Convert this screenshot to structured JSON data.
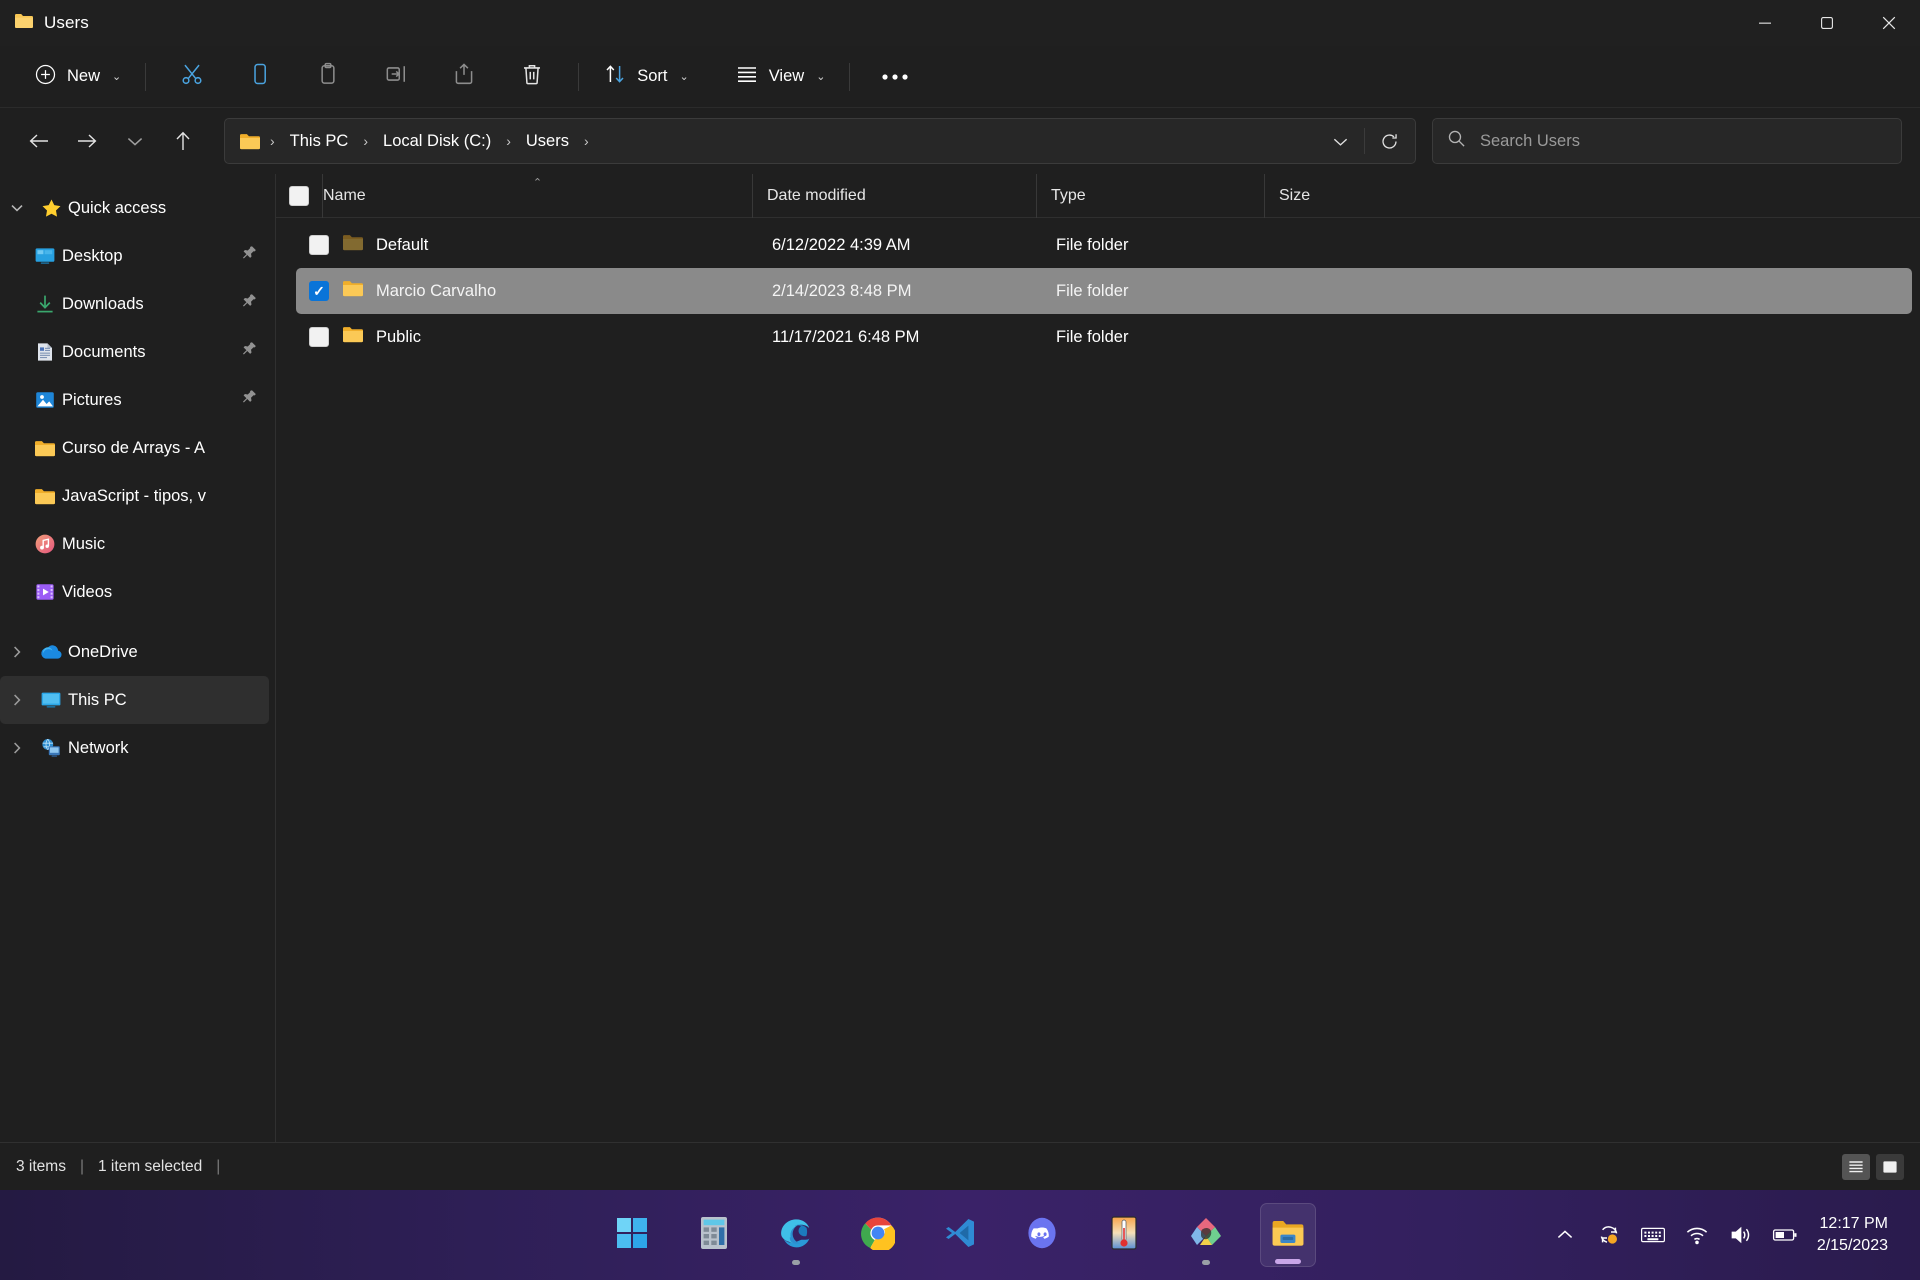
{
  "window": {
    "title": "Users",
    "title_icon": "folder-icon",
    "controls": {
      "minimize": "minimize-icon",
      "maximize": "maximize-icon",
      "close": "close-icon"
    }
  },
  "toolbar": {
    "new_label": "New",
    "new_icon": "plus-circle-icon",
    "actions": [
      {
        "name": "cut",
        "icon": "scissors-icon",
        "accent": true
      },
      {
        "name": "copy",
        "icon": "copy-icon",
        "accent": true
      },
      {
        "name": "paste",
        "icon": "clipboard-icon",
        "accent": false
      },
      {
        "name": "rename",
        "icon": "rename-icon",
        "accent": false
      },
      {
        "name": "share",
        "icon": "share-icon",
        "accent": false
      },
      {
        "name": "delete",
        "icon": "trash-icon",
        "accent": false
      }
    ],
    "sort_label": "Sort",
    "sort_icon": "sort-arrows-icon",
    "view_label": "View",
    "view_icon": "list-lines-icon",
    "more_label": "...",
    "more_icon": "ellipsis-icon"
  },
  "navigation": {
    "back_icon": "arrow-left-icon",
    "forward_icon": "arrow-right-icon",
    "recent_icon": "chevron-down-icon",
    "up_icon": "arrow-up-icon",
    "breadcrumb_icon": "folder-icon",
    "breadcrumbs": [
      "This PC",
      "Local Disk (C:)",
      "Users"
    ],
    "separator": "›",
    "dropdown_icon": "chevron-down-icon",
    "refresh_icon": "refresh-icon"
  },
  "search": {
    "icon": "search-icon",
    "placeholder": "Search Users",
    "value": ""
  },
  "sidebar": {
    "items": [
      {
        "label": "Quick access",
        "icon": "star-icon",
        "level": 1,
        "expander": "chevron-down",
        "pinned": false,
        "selected": false
      },
      {
        "label": "Desktop",
        "icon": "desktop-icon",
        "level": 2,
        "expander": "none",
        "pinned": true,
        "selected": false
      },
      {
        "label": "Downloads",
        "icon": "download-icon",
        "level": 2,
        "expander": "none",
        "pinned": true,
        "selected": false
      },
      {
        "label": "Documents",
        "icon": "document-icon",
        "level": 2,
        "expander": "none",
        "pinned": true,
        "selected": false
      },
      {
        "label": "Pictures",
        "icon": "pictures-icon",
        "level": 2,
        "expander": "none",
        "pinned": true,
        "selected": false
      },
      {
        "label": "Curso de Arrays - A",
        "icon": "folder-icon",
        "level": 2,
        "expander": "none",
        "pinned": false,
        "selected": false
      },
      {
        "label": "JavaScript - tipos, v",
        "icon": "folder-icon",
        "level": 2,
        "expander": "none",
        "pinned": false,
        "selected": false
      },
      {
        "label": "Music",
        "icon": "music-icon",
        "level": 2,
        "expander": "none",
        "pinned": false,
        "selected": false
      },
      {
        "label": "Videos",
        "icon": "videos-icon",
        "level": 2,
        "expander": "none",
        "pinned": false,
        "selected": false
      },
      {
        "label": "OneDrive",
        "icon": "onedrive-icon",
        "level": 1,
        "expander": "chevron-right",
        "pinned": false,
        "selected": false
      },
      {
        "label": "This PC",
        "icon": "thispc-icon",
        "level": 1,
        "expander": "chevron-right",
        "pinned": false,
        "selected": true
      },
      {
        "label": "Network",
        "icon": "network-icon",
        "level": 1,
        "expander": "chevron-right",
        "pinned": false,
        "selected": false
      }
    ]
  },
  "filelist": {
    "columns": [
      {
        "key": "name",
        "label": "Name",
        "sorted": true,
        "sort_direction": "asc"
      },
      {
        "key": "date",
        "label": "Date modified",
        "sorted": false
      },
      {
        "key": "type",
        "label": "Type",
        "sorted": false
      },
      {
        "key": "size",
        "label": "Size",
        "sorted": false
      }
    ],
    "rows": [
      {
        "name": "Default",
        "date": "6/12/2022 4:39 AM",
        "type": "File folder",
        "size": "",
        "icon": "folder-icon-dim",
        "checked": false,
        "selected": false
      },
      {
        "name": "Marcio Carvalho",
        "date": "2/14/2023 8:48 PM",
        "type": "File folder",
        "size": "",
        "icon": "folder-icon",
        "checked": true,
        "selected": true
      },
      {
        "name": "Public",
        "date": "11/17/2021 6:48 PM",
        "type": "File folder",
        "size": "",
        "icon": "folder-icon",
        "checked": false,
        "selected": false
      }
    ]
  },
  "statusbar": {
    "item_count": "3 items",
    "selection": "1 item selected",
    "details_view_icon": "details-view-icon",
    "large_icons_view_icon": "large-icons-view-icon",
    "active_view": "details"
  },
  "taskbar": {
    "apps": [
      {
        "name": "start",
        "icon": "windows-logo-icon",
        "running": false,
        "active": false
      },
      {
        "name": "calculator",
        "icon": "calculator-icon",
        "running": false,
        "active": false
      },
      {
        "name": "edge",
        "icon": "edge-icon",
        "running": true,
        "active": false
      },
      {
        "name": "chrome",
        "icon": "chrome-icon",
        "running": false,
        "active": false
      },
      {
        "name": "vscode",
        "icon": "vscode-icon",
        "running": false,
        "active": false
      },
      {
        "name": "discord",
        "icon": "discord-icon",
        "running": false,
        "active": false
      },
      {
        "name": "thermometer-app",
        "icon": "thermometer-icon",
        "running": false,
        "active": false
      },
      {
        "name": "design-app",
        "icon": "diamond-icon",
        "running": true,
        "active": false
      },
      {
        "name": "file-explorer",
        "icon": "folder-icon",
        "running": true,
        "active": true
      }
    ],
    "tray": [
      {
        "name": "show-hidden-icons",
        "icon": "chevron-up-icon"
      },
      {
        "name": "sync-status",
        "icon": "sync-icon"
      },
      {
        "name": "touch-keyboard",
        "icon": "keyboard-icon"
      },
      {
        "name": "network",
        "icon": "wifi-icon"
      },
      {
        "name": "volume",
        "icon": "speaker-icon"
      },
      {
        "name": "battery",
        "icon": "battery-icon"
      }
    ],
    "clock": {
      "time": "12:17 PM",
      "date": "2/15/2023"
    }
  },
  "colors": {
    "accent": "#4cc2ff",
    "checkbox_checked": "#0a74d8",
    "selection_row": "#8a8a8a",
    "window_bg": "#1f1f1f",
    "taskbar_bg": "#2e1f56",
    "folder_yellow": "#ffd04c"
  }
}
